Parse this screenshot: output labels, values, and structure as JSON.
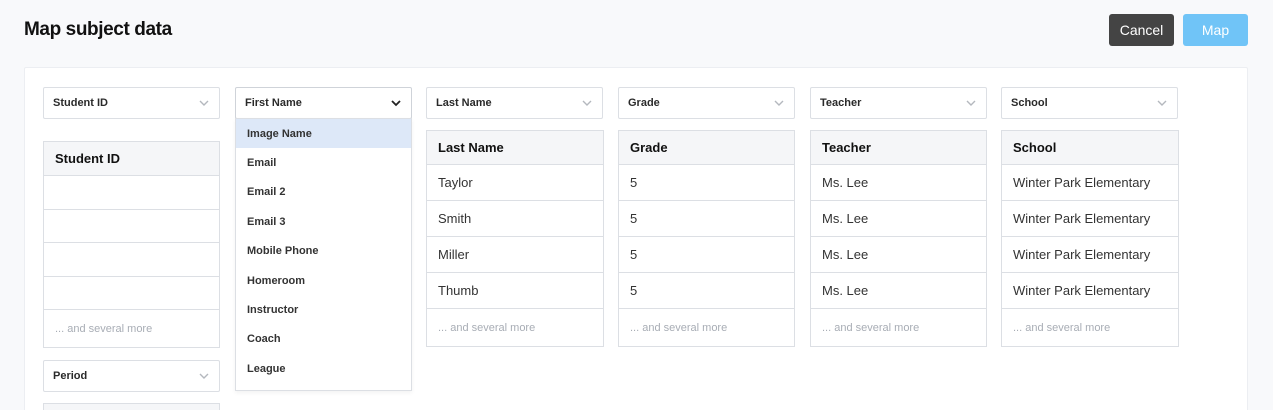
{
  "header": {
    "title": "Map subject data",
    "cancel_label": "Cancel",
    "map_label": "Map"
  },
  "selects": [
    {
      "label": "Student ID"
    },
    {
      "label": "First Name"
    },
    {
      "label": "Last Name"
    },
    {
      "label": "Grade"
    },
    {
      "label": "Teacher"
    },
    {
      "label": "School"
    },
    {
      "label": "Period"
    }
  ],
  "dropdown": {
    "options": [
      "Image Name",
      "Email",
      "Email 2",
      "Email 3",
      "Mobile Phone",
      "Homeroom",
      "Instructor",
      "Coach",
      "League"
    ],
    "highlighted": "Image Name"
  },
  "columns": [
    {
      "header": "Student ID",
      "cells": [
        "",
        "",
        "",
        ""
      ],
      "more": "... and several more"
    },
    {
      "header": "Last Name",
      "cells": [
        "Taylor",
        "Smith",
        "Miller",
        "Thumb"
      ],
      "more": "... and several more"
    },
    {
      "header": "Grade",
      "cells": [
        "5",
        "5",
        "5",
        "5"
      ],
      "more": "... and several more"
    },
    {
      "header": "Teacher",
      "cells": [
        "Ms. Lee",
        "Ms. Lee",
        "Ms. Lee",
        "Ms. Lee"
      ],
      "more": "... and several more"
    },
    {
      "header": "School",
      "cells": [
        "Winter Park Elementary",
        "Winter Park Elementary",
        "Winter Park Elementary",
        "Winter Park Elementary"
      ],
      "more": "... and several more"
    }
  ],
  "icons": {
    "select_caret": "chevron-down-icon"
  },
  "colors": {
    "map_button": "#70c4f7",
    "cancel_button": "#444444",
    "highlight": "#dde8f8"
  }
}
